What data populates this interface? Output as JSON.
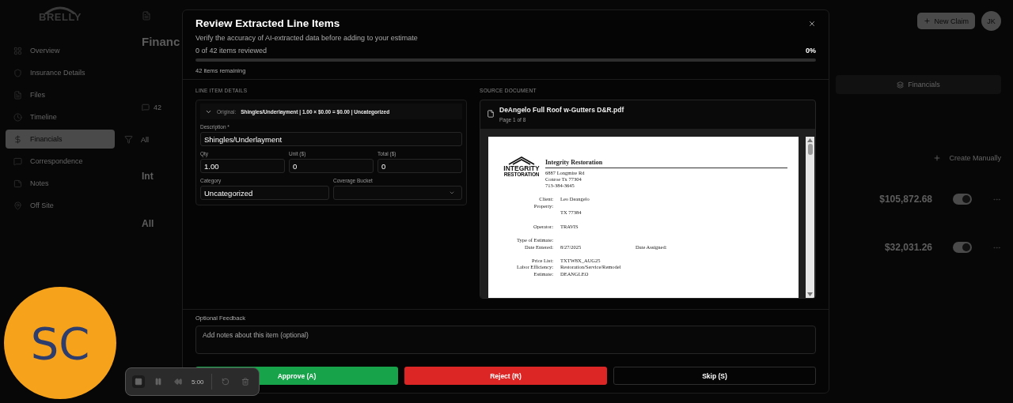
{
  "sidebar": {
    "logo": "BRELLY",
    "items": [
      {
        "label": "Overview",
        "selected": false
      },
      {
        "label": "Insurance Details",
        "selected": false
      },
      {
        "label": "Files",
        "selected": false
      },
      {
        "label": "Timeline",
        "selected": false
      },
      {
        "label": "Financials",
        "selected": true
      },
      {
        "label": "Correspondence",
        "selected": false
      },
      {
        "label": "Notes",
        "selected": false
      },
      {
        "label": "Off Site",
        "selected": false
      }
    ]
  },
  "page": {
    "title": "Financ",
    "count": "42",
    "filter": "All",
    "new_button": "New Claim",
    "user_initials": "JK",
    "tab": "Financials",
    "create_link": "Create Manually",
    "rows": [
      {
        "name": "Int",
        "amount": "$105,872.68",
        "on": true
      },
      {
        "name": "All",
        "amount": "$32,031.26",
        "on": true
      }
    ]
  },
  "modal": {
    "title": "Review Extracted Line Items",
    "subtitle": "Verify the accuracy of AI-extracted data before adding to your estimate",
    "progress_label": "0 of 42 items reviewed",
    "progress_percent": "0%",
    "progress": {
      "level": 0
    },
    "remaining": "42 items remaining",
    "details": {
      "heading": "LINE ITEM DETAILS",
      "original_label": "Original:",
      "original_value": "Shingles/Underlayment | 1.00 × $0.00 = $0.00 | Uncategorized",
      "expanded": true,
      "field_rows": [
        [
          {
            "label": "Description *",
            "value": "Shingles/Underlayment",
            "kind": "text"
          }
        ],
        [
          {
            "label": "Qty",
            "value": "1.00",
            "kind": "text"
          },
          {
            "label": "Unit ($)",
            "value": "0",
            "kind": "text"
          },
          {
            "label": "Total ($)",
            "value": "0",
            "kind": "text"
          }
        ],
        [
          {
            "label": "Category",
            "value": "Uncategorized",
            "kind": "text"
          },
          {
            "label": "Coverage Bucket",
            "kind": "select"
          }
        ]
      ]
    },
    "source": {
      "heading": "SOURCE DOCUMENT",
      "file_name": "DeAngelo Full Roof w-Gutters D&R.pdf",
      "page_label": "Page 1 of 8",
      "document": {
        "logo_lines": [
          "INTEGRITY",
          "RESTORATION"
        ],
        "company": "Integrity Restoration",
        "address": [
          "6887 Longmire Rd",
          "Conroe Tx 77304",
          "713-384-3645"
        ],
        "groups": [
          [
            {
              "label": "Client:",
              "value": "Leo Deangelo"
            },
            {
              "label": "Property:"
            },
            {
              "value": "TX 77384"
            }
          ],
          [
            {
              "label": "Operator:",
              "value": "TRAVIS"
            }
          ],
          [
            {
              "label": "Type of Estimate:"
            },
            {
              "label": "Date Entered:",
              "value": "8/27/2025",
              "aside": "Date Assigned:"
            }
          ],
          [
            {
              "label": "Price List:",
              "value": "TXTW8X_AUG25"
            },
            {
              "label": "Labor Efficiency:",
              "value": "Restoration/Service/Remodel"
            },
            {
              "label": "Estimate:",
              "value": "DEANGLEO"
            }
          ]
        ]
      }
    },
    "feedback": {
      "label": "Optional Feedback",
      "placeholder": "Add notes about this item (optional)"
    },
    "buttons": [
      {
        "label": "Approve (A)",
        "kind": "approve"
      },
      {
        "label": "Reject (R)",
        "kind": "reject"
      },
      {
        "label": "Skip (S)",
        "kind": "skip"
      }
    ]
  },
  "recorder": {
    "time": "5:00",
    "badge": "SC"
  }
}
